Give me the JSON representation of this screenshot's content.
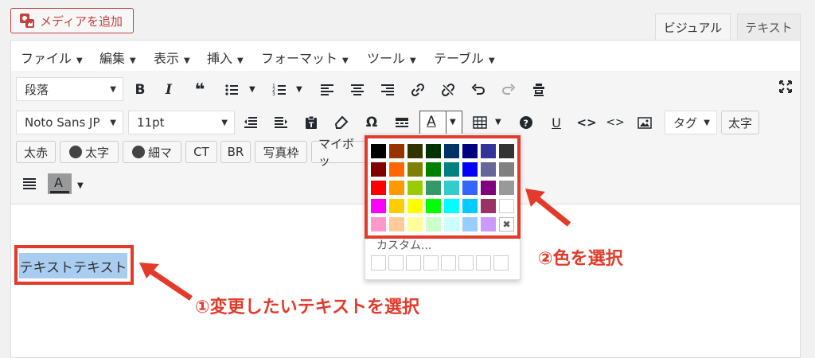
{
  "media_button": {
    "label": "メディアを追加"
  },
  "tabs": {
    "visual": "ビジュアル",
    "text": "テキスト"
  },
  "menu": [
    "ファイル",
    "編集",
    "表示",
    "挿入",
    "フォーマット",
    "ツール",
    "テーブル"
  ],
  "toolbar": {
    "format_select": "段落",
    "font_select": "Noto Sans JP",
    "size_select": "11pt",
    "tag_select": "タグ",
    "bold_btn": "太字",
    "pills": [
      "太赤",
      "太字",
      "細マ",
      "CT",
      "BR",
      "写真枠",
      "マイボッ"
    ]
  },
  "editor": {
    "selected_text": "テキストテキスト"
  },
  "color_panel": {
    "custom_label": "カスタム...",
    "rows": [
      [
        "#000000",
        "#993300",
        "#333300",
        "#003300",
        "#003366",
        "#000080",
        "#333399",
        "#333333"
      ],
      [
        "#800000",
        "#ff6600",
        "#808000",
        "#008000",
        "#008080",
        "#0000ff",
        "#666699",
        "#808080"
      ],
      [
        "#ff0000",
        "#ff9900",
        "#99cc00",
        "#339966",
        "#33cccc",
        "#3366ff",
        "#800080",
        "#999999"
      ],
      [
        "#ff00ff",
        "#ffcc00",
        "#ffff00",
        "#00ff00",
        "#00ffff",
        "#00ccff",
        "#993366",
        "#ffffff"
      ],
      [
        "#ff99cc",
        "#ffcc99",
        "#ffff99",
        "#ccffcc",
        "#ccffff",
        "#99ccff",
        "#cc99ff",
        "remove"
      ]
    ]
  },
  "annotations": {
    "step1": "①変更したいテキストを選択",
    "step2": "②色を選択"
  },
  "colors": {
    "accent_red": "#e33a2a",
    "selection": "#a9ccf1"
  }
}
